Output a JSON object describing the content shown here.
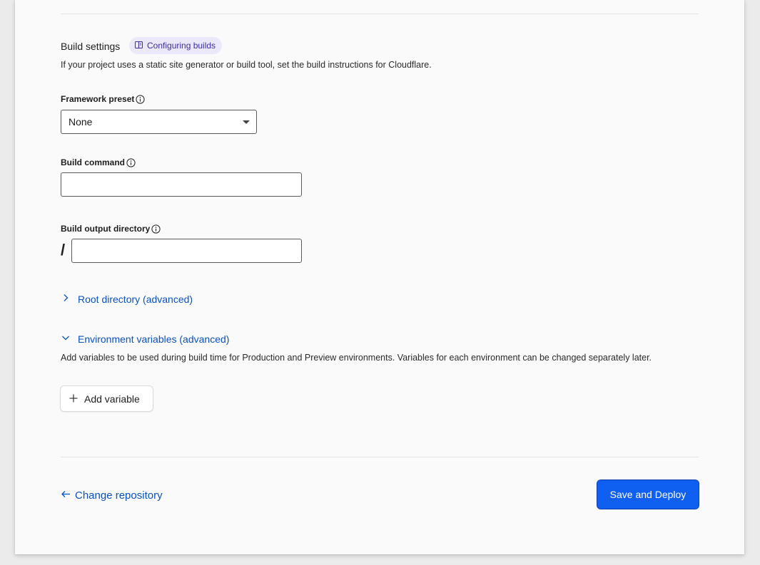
{
  "build_settings": {
    "title": "Build settings",
    "docs_link": "Configuring builds",
    "description": "If your project uses a static site generator or build tool, set the build instructions for Cloudflare."
  },
  "framework_preset": {
    "label": "Framework preset",
    "value": "None"
  },
  "build_command": {
    "label": "Build command",
    "value": ""
  },
  "build_output": {
    "label": "Build output directory",
    "prefix": "/",
    "value": ""
  },
  "root_directory": {
    "label": "Root directory (advanced)"
  },
  "env_vars": {
    "label": "Environment variables (advanced)",
    "description": "Add variables to be used during build time for Production and Preview environments. Variables for each environment can be changed separately later.",
    "add_button": "Add variable"
  },
  "footer": {
    "back_link": "Change repository",
    "submit": "Save and Deploy"
  },
  "colors": {
    "accent": "#0f60f0",
    "link": "#0a52bf",
    "pill_bg": "#ece8fb"
  },
  "icons": [
    "book-icon",
    "info-icon",
    "chevron-right-icon",
    "chevron-down-icon",
    "plus-icon",
    "arrow-left-icon"
  ]
}
